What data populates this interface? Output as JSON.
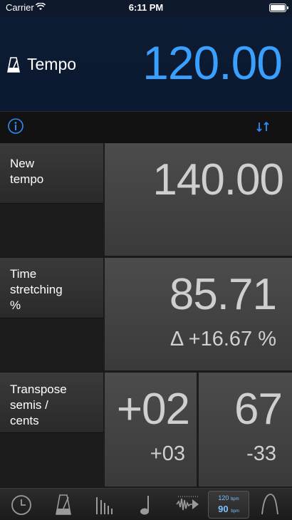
{
  "status_bar": {
    "carrier": "Carrier",
    "time": "6:11 PM"
  },
  "header": {
    "title": "Tempo",
    "value": "120.00",
    "accent": "#3aa0ff"
  },
  "new_tempo": {
    "label_line1": "New",
    "label_line2": "tempo",
    "value": "140.00"
  },
  "time_stretching": {
    "label_line1": "Time",
    "label_line2": "stretching",
    "label_line3": "%",
    "value": "85.71",
    "delta": "Δ +16.67 %"
  },
  "transpose": {
    "label_line1": "Transpose",
    "label_line2": "semis /",
    "label_line3": "cents",
    "semis_value": "+02",
    "semis_sub": "+03",
    "cents_value": "67",
    "cents_sub": "-33"
  },
  "tab_bar": {
    "tabs": [
      {
        "icon": "clock-icon"
      },
      {
        "icon": "metronome-icon"
      },
      {
        "icon": "bars-icon"
      },
      {
        "icon": "note-icon"
      },
      {
        "icon": "waveform-icon"
      },
      {
        "icon": "tempo-bpm-icon",
        "bpm_top": "120",
        "bpm_bottom": "90",
        "unit": "bpm",
        "active": true
      },
      {
        "icon": "curve-icon"
      }
    ]
  }
}
